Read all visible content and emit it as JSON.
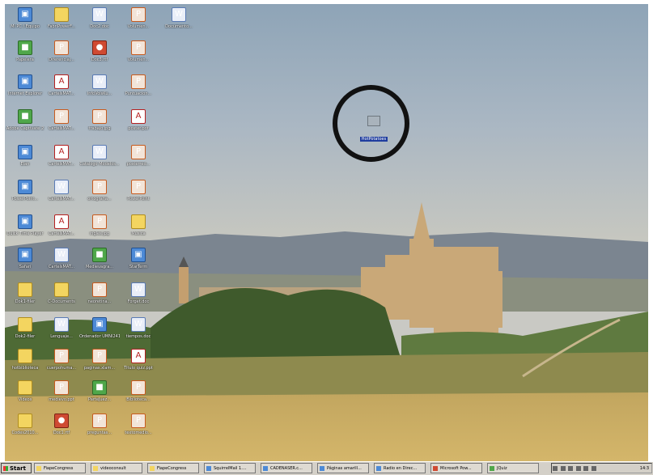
{
  "desktop": {
    "icons": [
      {
        "label": "Mi PC / Equipo",
        "type": "app"
      },
      {
        "label": "FabriPowerF...",
        "type": "folder"
      },
      {
        "label": "Doc2.doc",
        "type": "doc"
      },
      {
        "label": "Volumen...",
        "type": "ppt"
      },
      {
        "label": "Documento...",
        "type": "doc"
      },
      {
        "label": "Papelera",
        "type": "green"
      },
      {
        "label": "Diferenciaj...",
        "type": "ppt"
      },
      {
        "label": "Doc3.rtf",
        "type": "red"
      },
      {
        "label": "Volumen...",
        "type": "ppt"
      },
      {
        "label": "Internet Explorer",
        "type": "app"
      },
      {
        "label": "CartelsMAT...",
        "type": "pdf"
      },
      {
        "label": "InfoVoisKu...",
        "type": "doc"
      },
      {
        "label": "Puntuacion...",
        "type": "ppt"
      },
      {
        "label": "Adobe Captivate 2",
        "type": "green"
      },
      {
        "label": "CartelsMAT...",
        "type": "ppt"
      },
      {
        "label": "trabajo.jpg",
        "type": "ppt"
      },
      {
        "label": "poster.pdf",
        "type": "pdf"
      },
      {
        "label": "Elan",
        "type": "app"
      },
      {
        "label": "CartelsMAT...",
        "type": "pdf"
      },
      {
        "label": "Catalogo Modelos...",
        "type": "doc"
      },
      {
        "label": "posterred...",
        "type": "ppt"
      },
      {
        "label": "PowerPoint...",
        "type": "app"
      },
      {
        "label": "CartelsMAT...",
        "type": "doc"
      },
      {
        "label": "ortografia...",
        "type": "ppt"
      },
      {
        "label": "PowerPoint",
        "type": "ppt"
      },
      {
        "label": "Quick Time Player",
        "type": "app"
      },
      {
        "label": "CartelsMAT...",
        "type": "pdf"
      },
      {
        "label": "ingles.jpg",
        "type": "ppt"
      },
      {
        "label": "Musica",
        "type": "folder"
      },
      {
        "label": "Safari",
        "type": "app"
      },
      {
        "label": "CartelsMAT...",
        "type": "doc"
      },
      {
        "label": "Medievagra...",
        "type": "green"
      },
      {
        "label": "StarTerm",
        "type": "app"
      },
      {
        "label": "Dok1-filer",
        "type": "folder"
      },
      {
        "label": "C-Documents",
        "type": "folder"
      },
      {
        "label": "neoretina...",
        "type": "ppt"
      },
      {
        "label": "Forget.doc",
        "type": "doc"
      },
      {
        "label": "Dok2-filer",
        "type": "folder"
      },
      {
        "label": "Lenguaje...",
        "type": "doc"
      },
      {
        "label": "Ordenador UMNI241",
        "type": "app"
      },
      {
        "label": "tiempos.doc",
        "type": "doc"
      },
      {
        "label": "hotbiblioteca",
        "type": "folder"
      },
      {
        "label": "cuerpohuma...",
        "type": "ppt"
      },
      {
        "label": "paginas.xlam...",
        "type": "ppt"
      },
      {
        "label": "Titulo quiz.ppt",
        "type": "pdf"
      },
      {
        "label": "Videos",
        "type": "folder"
      },
      {
        "label": "medievo.ppt",
        "type": "ppt"
      },
      {
        "label": "ParteJuez...",
        "type": "green"
      },
      {
        "label": "Biblioteca...",
        "type": "ppt"
      },
      {
        "label": "Codes2010...",
        "type": "folder"
      },
      {
        "label": "Doc1.rtf",
        "type": "red"
      },
      {
        "label": "preguntas...",
        "type": "ppt"
      },
      {
        "label": "textomedio...",
        "type": "ppt"
      }
    ],
    "selected_icon": {
      "label": "HotPotatoes"
    }
  },
  "taskbar": {
    "start_label": "Start",
    "tasks": [
      "FiapeCongress",
      "videoconsult",
      "FiapeCongress",
      "SquirrelMail 1....",
      "CADENASER.c...",
      "Páginas amarill...",
      "Radio en Direc...",
      "Microsoft Pow...",
      "JQuiz"
    ],
    "clock": "14:3"
  }
}
